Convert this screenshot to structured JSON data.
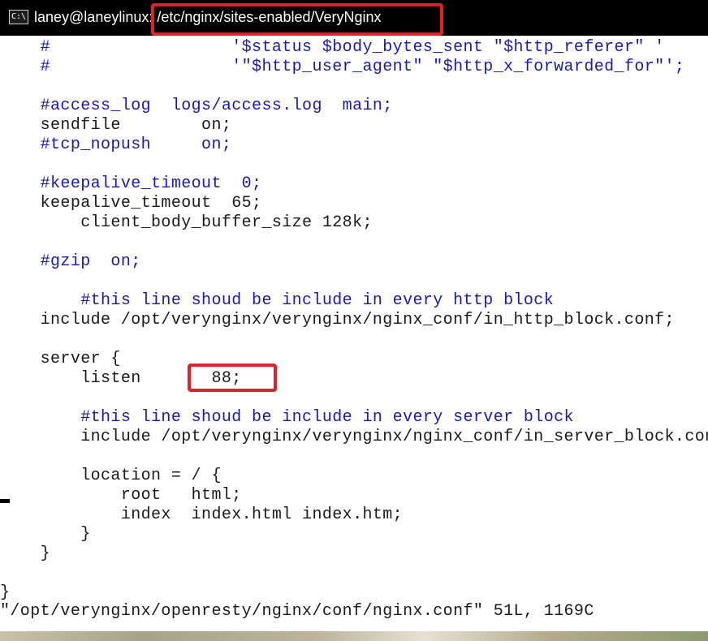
{
  "window": {
    "title": "laney@laneylinux: /etc/nginx/sites-enabled/VeryNginx",
    "icon": "terminal-icon",
    "icon_text": "C:\\",
    "highlight_color": "#e0202a"
  },
  "editor": {
    "lines": [
      "    #                  '$status $body_bytes_sent \"$http_referer\" '",
      "    #                  '\"$http_user_agent\" \"$http_x_forwarded_for\"';",
      "",
      "    #access_log  logs/access.log  main;",
      "    sendfile        on;",
      "    #tcp_nopush     on;",
      "",
      "    #keepalive_timeout  0;",
      "    keepalive_timeout  65;",
      "        client_body_buffer_size 128k;",
      "",
      "    #gzip  on;",
      "",
      "        #this line shoud be include in every http block",
      "    include /opt/verynginx/verynginx/nginx_conf/in_http_block.conf;",
      "",
      "    server {",
      "        listen       88;",
      "",
      "        #this line shoud be include in every server block",
      "        include /opt/verynginx/verynginx/nginx_conf/in_server_block.conf;",
      "",
      "        location = / {",
      "            root   html;",
      "            index  index.html index.htm;",
      "        }",
      "    }",
      "",
      "}"
    ],
    "status_line": "\"/opt/verynginx/openresty/nginx/conf/nginx.conf\" 51L, 1169C",
    "comment_color": "#1a1ab0"
  }
}
